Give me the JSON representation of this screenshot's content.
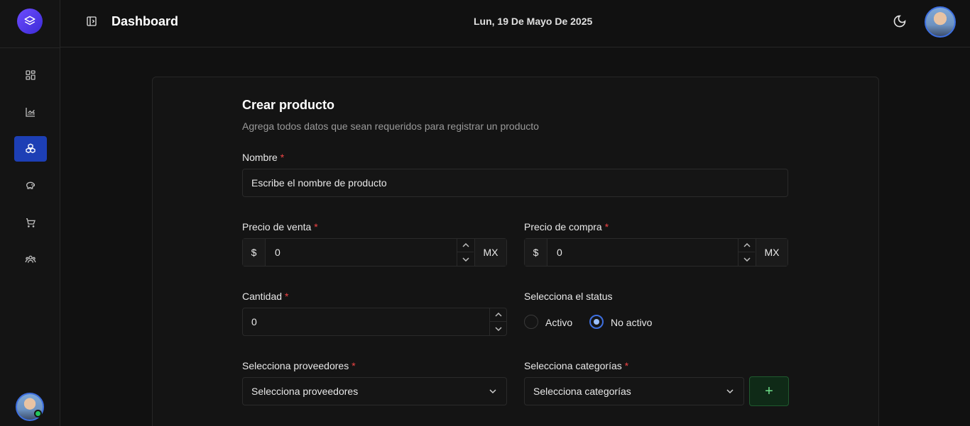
{
  "header": {
    "title": "Dashboard",
    "date": "Lun, 19 De Mayo De 2025"
  },
  "sidebar": {
    "items": [
      {
        "icon": "grid-icon"
      },
      {
        "icon": "chart-icon"
      },
      {
        "icon": "boxes-icon",
        "active": true
      },
      {
        "icon": "piggy-bank-icon"
      },
      {
        "icon": "cart-icon"
      },
      {
        "icon": "users-icon"
      }
    ]
  },
  "form": {
    "title": "Crear producto",
    "subtitle": "Agrega todos datos que sean requeridos para registrar un producto",
    "name": {
      "label": "Nombre",
      "placeholder": "Escribe el nombre de producto"
    },
    "sale_price": {
      "label": "Precio de venta",
      "prefix": "$",
      "value": "0",
      "suffix": "MX"
    },
    "purchase_price": {
      "label": "Precio de compra",
      "prefix": "$",
      "value": "0",
      "suffix": "MX"
    },
    "quantity": {
      "label": "Cantidad",
      "value": "0"
    },
    "status": {
      "label": "Selecciona el status",
      "options": [
        "Activo",
        "No activo"
      ],
      "selected": "No activo"
    },
    "suppliers": {
      "label": "Selecciona proveedores",
      "placeholder": "Selecciona proveedores"
    },
    "categories": {
      "label": "Selecciona categorías",
      "placeholder": "Selecciona categorías"
    },
    "add_button": "+"
  },
  "colors": {
    "accent": "#1d3fb5",
    "required": "#ef4444",
    "add_button": "#0f2a17"
  }
}
